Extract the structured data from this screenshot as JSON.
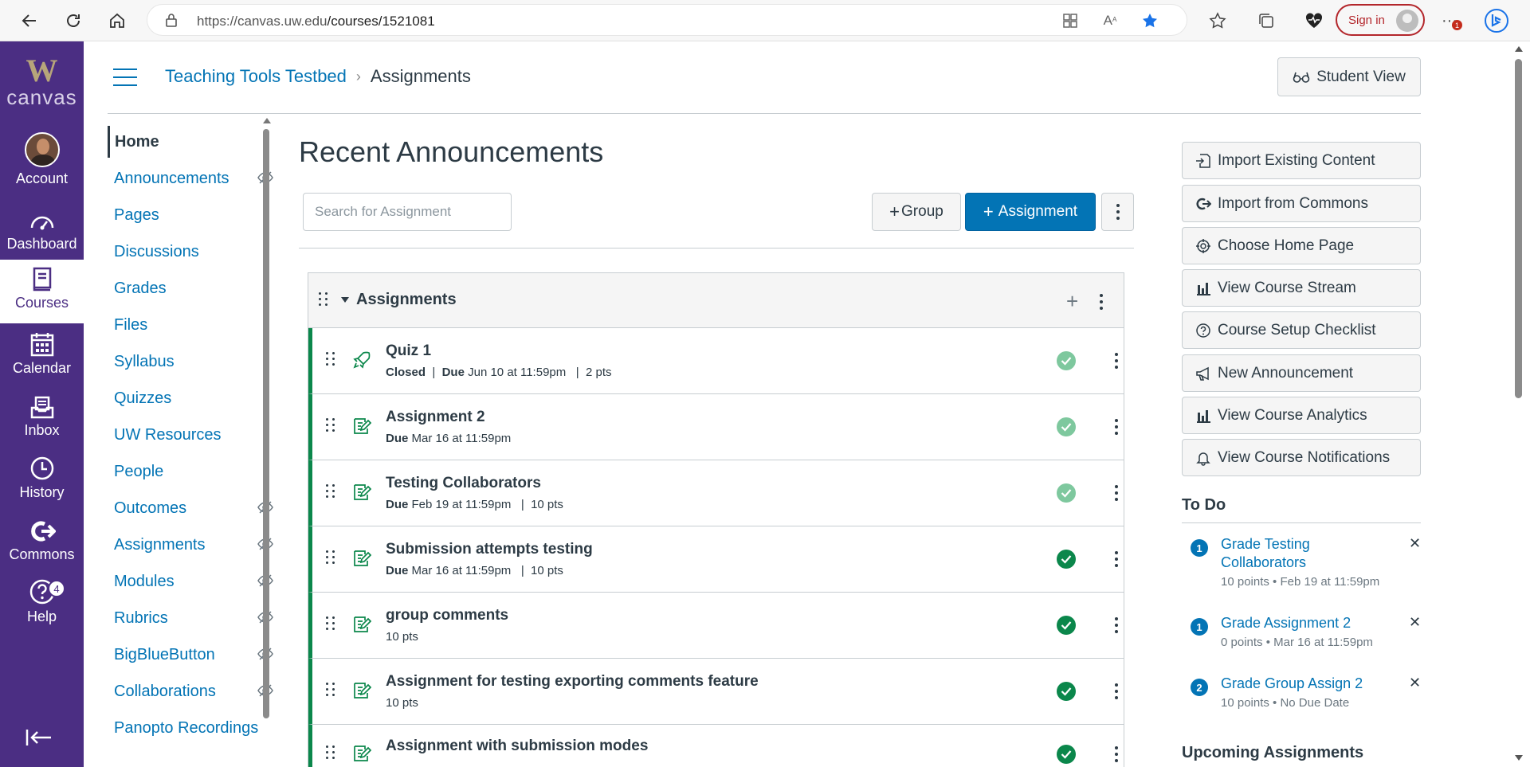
{
  "browser": {
    "url_host": "https://canvas.uw.edu",
    "url_path": "/courses/1521081",
    "signin_label": "Sign in",
    "notification_badge": "1"
  },
  "global_nav": {
    "logo_mark": "W",
    "logo_text": "canvas",
    "items": [
      {
        "label": "Account",
        "icon": "avatar"
      },
      {
        "label": "Dashboard",
        "icon": "dashboard-icon"
      },
      {
        "label": "Courses",
        "icon": "courses-icon"
      },
      {
        "label": "Calendar",
        "icon": "calendar-icon"
      },
      {
        "label": "Inbox",
        "icon": "inbox-icon"
      },
      {
        "label": "History",
        "icon": "history-icon"
      },
      {
        "label": "Commons",
        "icon": "commons-icon"
      },
      {
        "label": "Help",
        "icon": "help-icon",
        "badge": "4"
      }
    ]
  },
  "header": {
    "course_link": "Teaching Tools Testbed",
    "separator": "›",
    "current": "Assignments",
    "student_view_label": "Student View"
  },
  "course_nav": {
    "items": [
      {
        "label": "Home",
        "active": true,
        "hidden": false
      },
      {
        "label": "Announcements",
        "hidden": true
      },
      {
        "label": "Pages",
        "hidden": false
      },
      {
        "label": "Discussions",
        "hidden": false
      },
      {
        "label": "Grades",
        "hidden": false
      },
      {
        "label": "Files",
        "hidden": false
      },
      {
        "label": "Syllabus",
        "hidden": false
      },
      {
        "label": "Quizzes",
        "hidden": false
      },
      {
        "label": "UW Resources",
        "hidden": false
      },
      {
        "label": "People",
        "hidden": false
      },
      {
        "label": "Outcomes",
        "hidden": true
      },
      {
        "label": "Assignments",
        "hidden": true
      },
      {
        "label": "Modules",
        "hidden": true
      },
      {
        "label": "Rubrics",
        "hidden": true
      },
      {
        "label": "BigBlueButton",
        "hidden": true
      },
      {
        "label": "Collaborations",
        "hidden": true
      },
      {
        "label": "Panopto Recordings",
        "hidden": false
      }
    ]
  },
  "main": {
    "title": "Recent Announcements",
    "search_placeholder": "Search for Assignment",
    "group_button": "Group",
    "assignment_button": "Assignment",
    "group_name": "Assignments",
    "assignments": [
      {
        "title": "Quiz 1",
        "icon": "quiz-rocket-icon",
        "status": "Closed",
        "due_label": "Due",
        "due": "Jun 10 at 11:59pm",
        "points": "2 pts",
        "published": "light"
      },
      {
        "title": "Assignment 2",
        "icon": "assignment-icon",
        "status": "",
        "due_label": "Due",
        "due": "Mar 16 at 11:59pm",
        "points": "",
        "published": "light"
      },
      {
        "title": "Testing Collaborators",
        "icon": "assignment-icon",
        "status": "",
        "due_label": "Due",
        "due": "Feb 19 at 11:59pm",
        "points": "10 pts",
        "published": "light"
      },
      {
        "title": "Submission attempts testing",
        "icon": "assignment-icon",
        "status": "",
        "due_label": "Due",
        "due": "Mar 16 at 11:59pm",
        "points": "10 pts",
        "published": "dark"
      },
      {
        "title": "group comments",
        "icon": "assignment-icon",
        "status": "",
        "due_label": "",
        "due": "",
        "points": "10 pts",
        "published": "dark"
      },
      {
        "title": "Assignment for testing exporting comments feature",
        "icon": "assignment-icon",
        "status": "",
        "due_label": "",
        "due": "",
        "points": "10 pts",
        "published": "dark"
      },
      {
        "title": "Assignment with submission modes",
        "icon": "assignment-icon",
        "status": "",
        "due_label": "",
        "due": "",
        "points": "",
        "published": "dark"
      }
    ]
  },
  "sidebar": {
    "buttons": [
      {
        "label": "Import Existing Content",
        "icon": "import-icon"
      },
      {
        "label": "Import from Commons",
        "icon": "commons-share-icon"
      },
      {
        "label": "Choose Home Page",
        "icon": "target-icon"
      },
      {
        "label": "View Course Stream",
        "icon": "bar-chart-icon"
      },
      {
        "label": "Course Setup Checklist",
        "icon": "question-circle-icon"
      },
      {
        "label": "New Announcement",
        "icon": "megaphone-icon"
      },
      {
        "label": "View Course Analytics",
        "icon": "bar-chart-icon"
      },
      {
        "label": "View Course Notifications",
        "icon": "bell-icon"
      }
    ],
    "todo_title": "To Do",
    "todo": [
      {
        "count": "1",
        "label": "Grade Testing Collaborators",
        "meta": "10 points • Feb 19 at 11:59pm"
      },
      {
        "count": "1",
        "label": "Grade Assignment 2",
        "meta": "0 points • Mar 16 at 11:59pm"
      },
      {
        "count": "2",
        "label": "Grade Group Assign 2",
        "meta": "10 points • No Due Date"
      }
    ],
    "upcoming_title": "Upcoming Assignments"
  }
}
